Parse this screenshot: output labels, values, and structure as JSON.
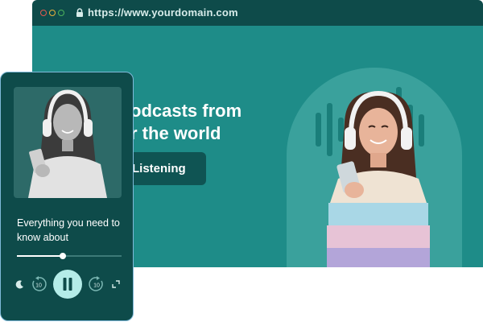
{
  "browser": {
    "url": "https://www.yourdomain.com"
  },
  "hero": {
    "headline_line1": "odcasts from",
    "headline_line2": "r the world",
    "cta_label": "Listening"
  },
  "player": {
    "track_title": "Everything you need to know about",
    "progress": 0.44,
    "rewind_label": "10",
    "forward_label": "10"
  },
  "colors": {
    "browser_bar": "#0e4b4a",
    "hero_bg": "#1e8c88",
    "cta_bg": "#0f5453",
    "play_button": "#b4ece8"
  }
}
